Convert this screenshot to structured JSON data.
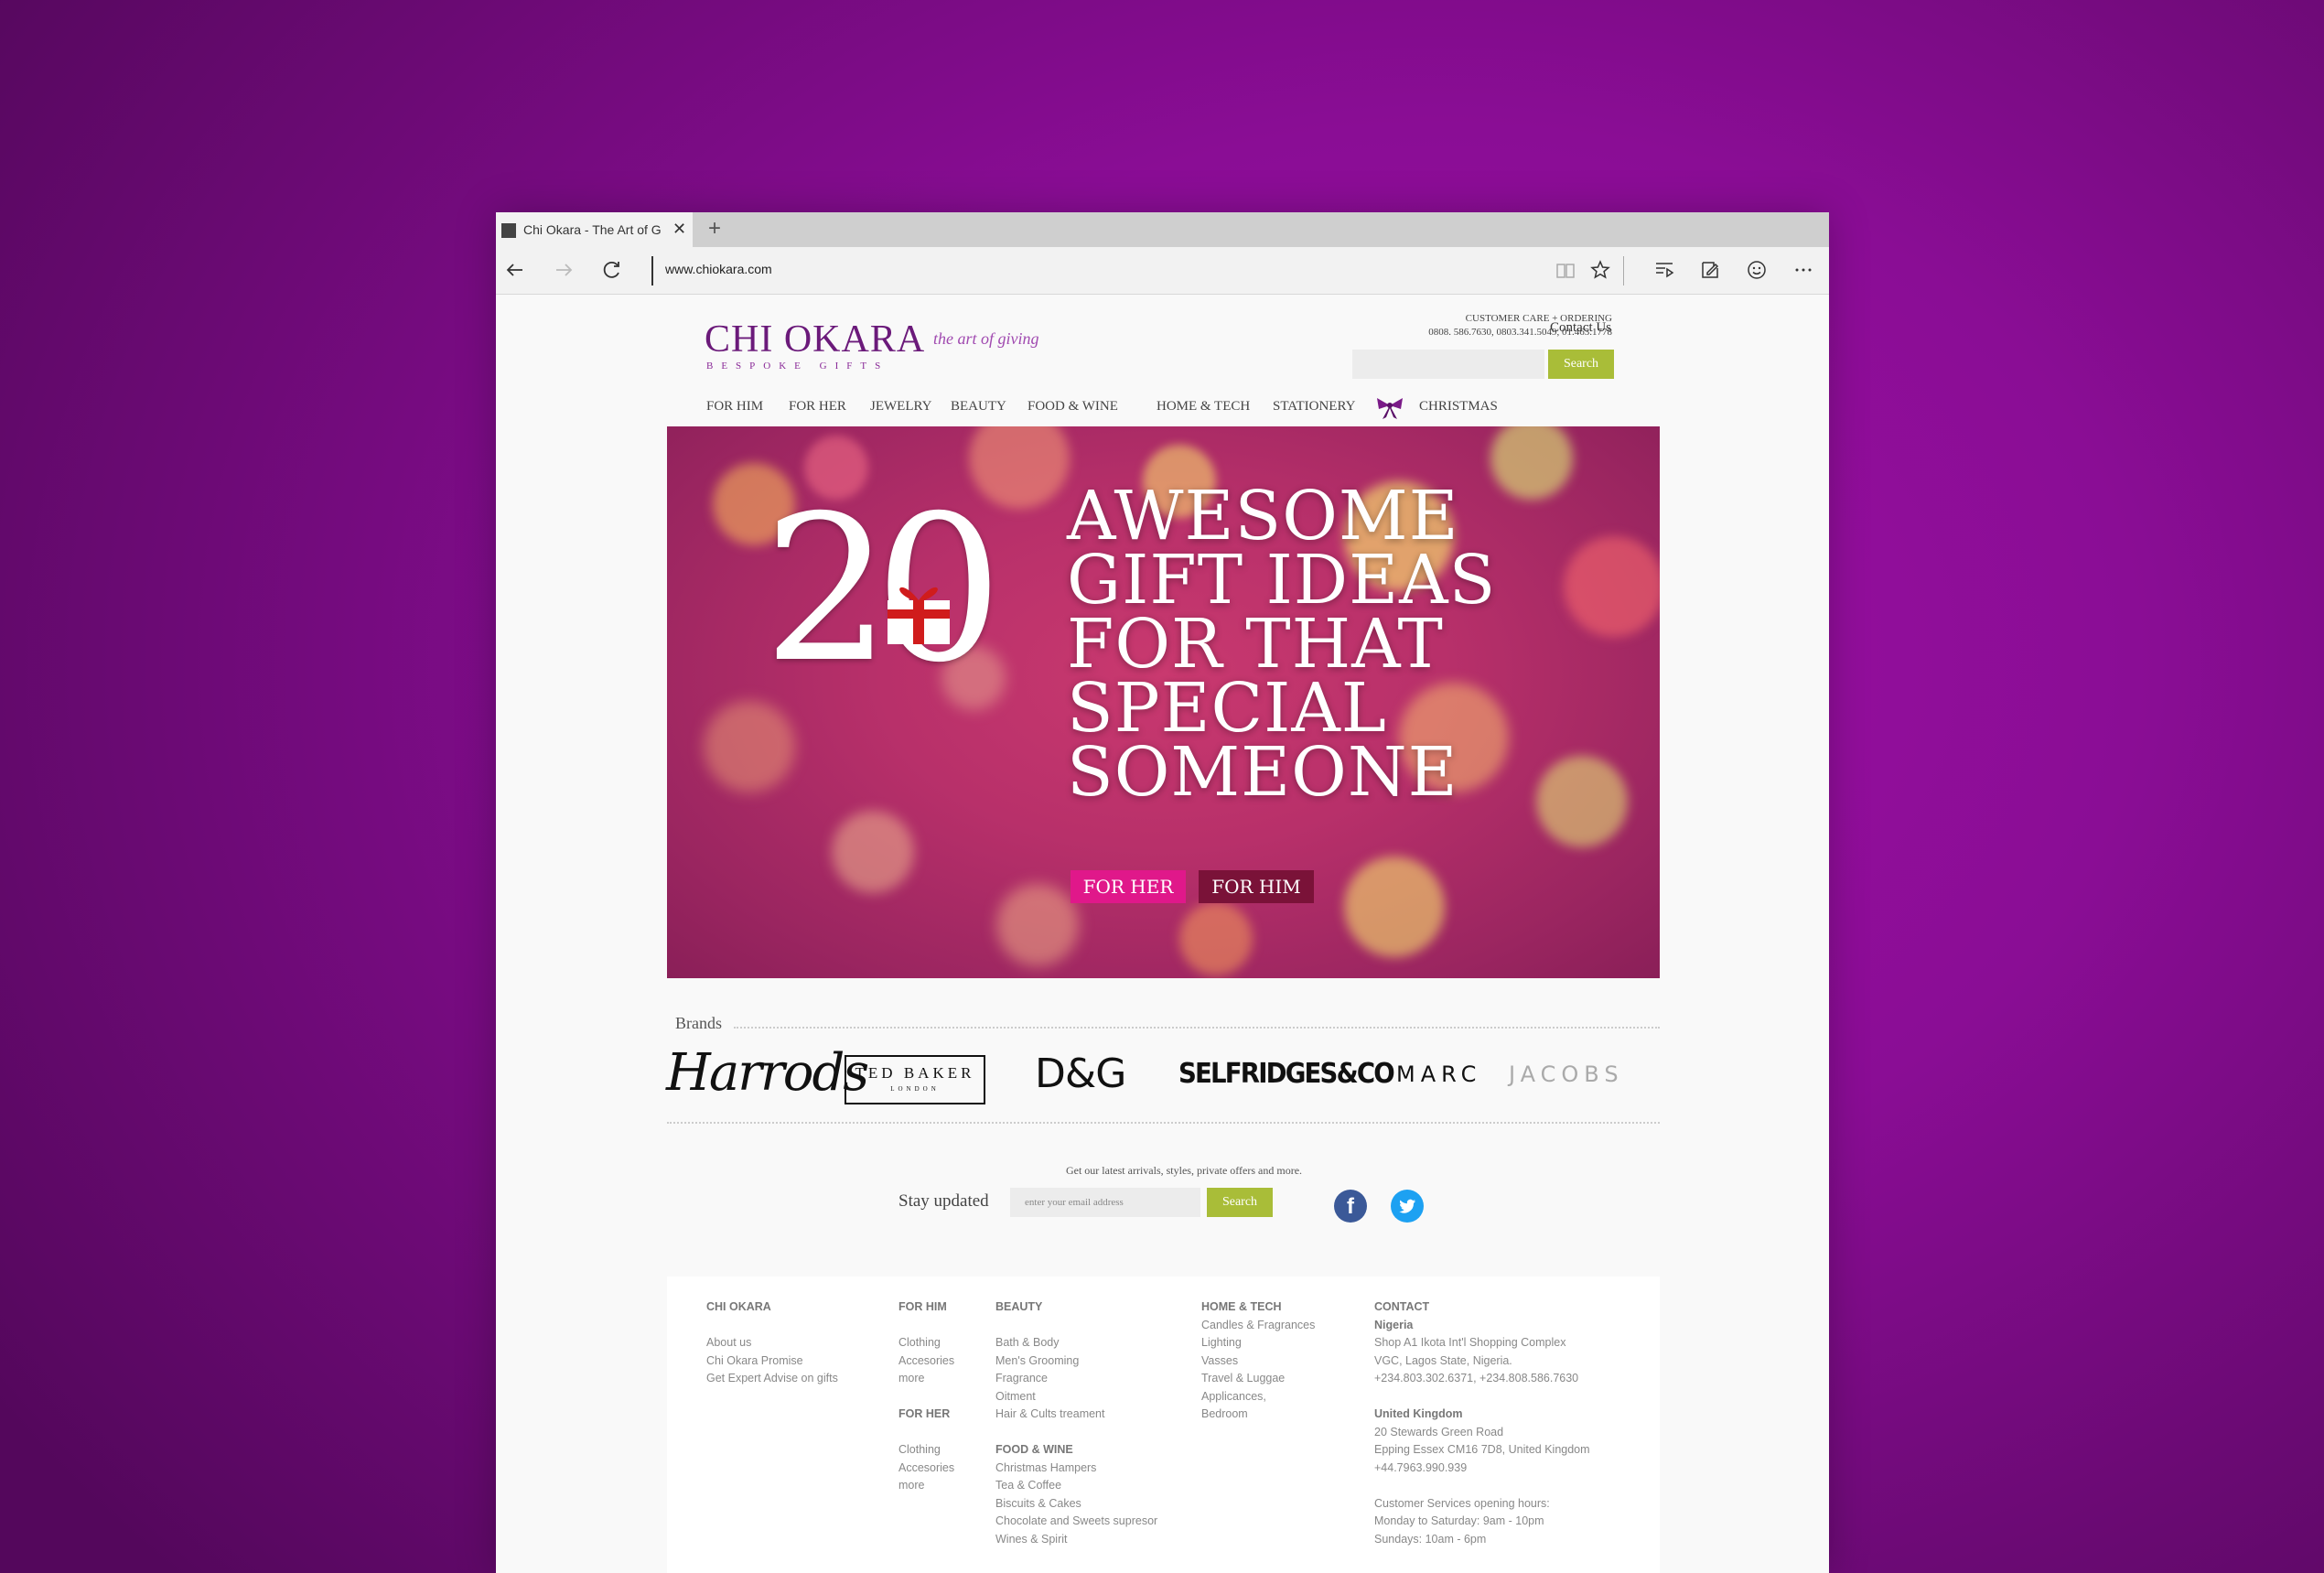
{
  "browser": {
    "tab_title": "Chi Okara - The Art of Giv",
    "tab_close": "✕",
    "new_tab": "+",
    "url": "www.chiokara.com"
  },
  "header": {
    "logo_name": "CHI OKARA",
    "logo_tagline": "the art of giving",
    "logo_sub": "BESPOKE GIFTS",
    "care_title": "CUSTOMER CARE + ORDERING",
    "care_phones": "0808. 586.7630, 0803.341.5049, 01.463.1778",
    "contact_link": "Contact Us",
    "search_button": "Search"
  },
  "nav": {
    "items": [
      "FOR HIM",
      "FOR HER",
      "JEWELRY",
      "BEAUTY",
      "FOOD & WINE",
      "HOME & TECH",
      "STATIONERY",
      "CHRISTMAS"
    ]
  },
  "hero": {
    "number": "20",
    "lines": [
      "AWESOME",
      "GIFT IDEAS",
      "FOR THAT",
      "SPECIAL",
      "SOMEONE"
    ],
    "btn_her": "FOR HER",
    "btn_him": "FOR HIM"
  },
  "brands": {
    "label": "Brands",
    "harrods": "Harrods",
    "ted_name": "TED BAKER",
    "ted_sub": "LONDON",
    "dg": "D&G",
    "selfridges": "SELFRIDGES&CO",
    "marc": "MARC",
    "jacobs": "JACOBS"
  },
  "newsletter": {
    "text": "Get our latest arrivals, styles, private offers and more.",
    "label": "Stay updated",
    "placeholder": "enter your email address",
    "button": "Search",
    "facebook": "f"
  },
  "footer": {
    "chi": {
      "title": "CHI OKARA",
      "links": [
        "About us",
        "Chi Okara Promise",
        "Get Expert Advise on gifts"
      ]
    },
    "him": {
      "title": "FOR HIM",
      "links": [
        "Clothing",
        "Accesories",
        "more"
      ]
    },
    "her": {
      "title": "FOR HER",
      "links": [
        "Clothing",
        "Accesories",
        "more"
      ]
    },
    "beauty": {
      "title": "BEAUTY",
      "links": [
        "Bath & Body",
        "Men's Grooming",
        "Fragrance",
        "Oitment",
        "Hair & Cults treament"
      ]
    },
    "food": {
      "title": "FOOD & WINE",
      "links": [
        "Christmas Hampers",
        "Tea & Coffee",
        "Biscuits & Cakes",
        "Chocolate and Sweets supresor",
        "Wines & Spirit"
      ]
    },
    "home": {
      "title": "HOME & TECH",
      "links": [
        "Candles & Fragrances",
        "Lighting",
        "Vasses",
        "Travel & Luggae",
        "Applicances,",
        "Bedroom"
      ]
    },
    "contact": {
      "title": "CONTACT",
      "ng_title": "Nigeria",
      "ng_lines": [
        "Shop A1 Ikota Int'l Shopping Complex",
        "VGC, Lagos State, Nigeria.",
        "+234.803.302.6371, +234.808.586.7630"
      ],
      "uk_title": "United Kingdom",
      "uk_lines": [
        "20 Stewards Green Road",
        "Epping Essex CM16 7D8, United Kingdom",
        "+44.7963.990.939"
      ],
      "hours": [
        "Customer Services opening hours:",
        "Monday to Saturday: 9am - 10pm",
        "Sundays: 10am - 6pm"
      ]
    }
  },
  "colors": {
    "brand_purple": "#6b1a7a",
    "accent_green": "#a9bd38",
    "for_her_pink": "#e0188a",
    "for_him_maroon": "#7a1238",
    "background_purple": "#8a0d95"
  }
}
